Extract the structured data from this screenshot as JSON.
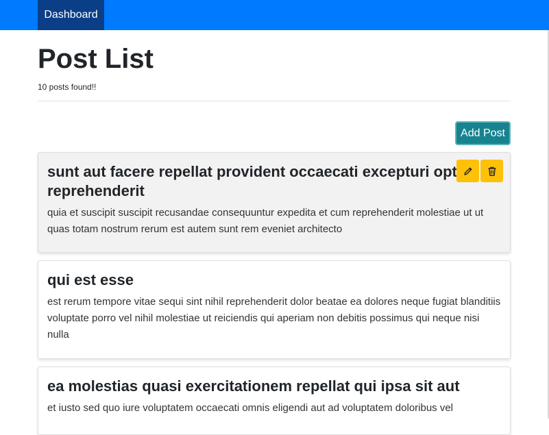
{
  "nav": {
    "brand": "Dashboard"
  },
  "header": {
    "title": "Post List",
    "count_text": "10 posts found!!"
  },
  "toolbar": {
    "add_label": "Add Post"
  },
  "posts": [
    {
      "title": "sunt aut facere repellat provident occaecati excepturi optio reprehenderit",
      "body": "quia et suscipit suscipit recusandae consequuntur expedita et cum reprehenderit molestiae ut ut quas totam nostrum rerum est autem sunt rem eveniet architecto"
    },
    {
      "title": "qui est esse",
      "body": "est rerum tempore vitae sequi sint nihil reprehenderit dolor beatae ea dolores neque fugiat blanditiis voluptate porro vel nihil molestiae ut reiciendis qui aperiam non debitis possimus qui neque nisi nulla"
    },
    {
      "title": "ea molestias quasi exercitationem repellat qui ipsa sit aut",
      "body": "et iusto sed quo iure voluptatem occaecati omnis eligendi aut ad voluptatem doloribus vel"
    }
  ],
  "card_actions": {
    "edit_icon": "pencil-icon",
    "delete_icon": "trash-icon"
  },
  "colors": {
    "navbar": "#007bff",
    "brand_active": "#0a3f87",
    "add_button": "#17838f",
    "action_button": "#ffc107",
    "active_card": "#f2f2f2"
  }
}
